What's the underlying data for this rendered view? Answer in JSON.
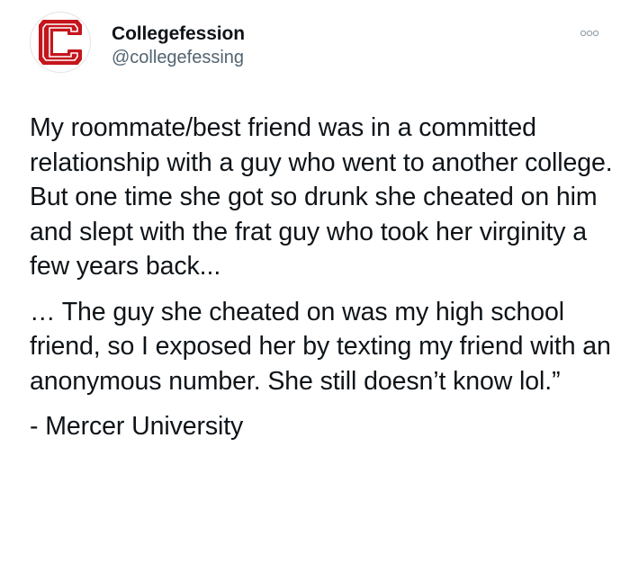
{
  "tweet": {
    "author": {
      "display_name": "Collegefession",
      "handle": "@collegefessing",
      "avatar_letter": "C",
      "avatar_color": "#c4161c",
      "avatar_icon": "collegefession-logo-icon"
    },
    "more_icon": "more-options-icon",
    "paragraphs": [
      "My roommate/best friend was in a committed relationship with a guy who went to another college. But one time she got so drunk she cheated on him and slept with the frat guy who took her virginity a few years back...",
      "… The guy she cheated on was my high school friend, so I exposed her by texting my friend with an anonymous number. She still doesn’t know lol.”"
    ],
    "signoff": "- Mercer University"
  },
  "colors": {
    "text": "#0f1419",
    "secondary": "#536471",
    "accent": "#c4161c"
  }
}
